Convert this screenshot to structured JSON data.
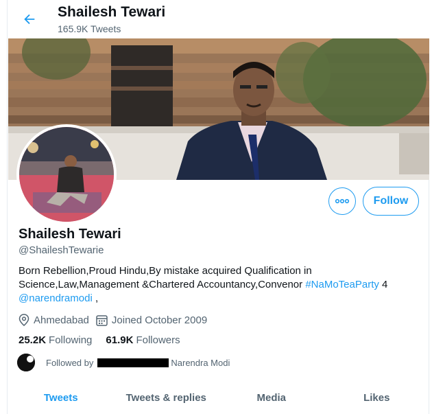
{
  "header": {
    "name": "Shailesh Tewari",
    "tweet_count": "165.9K Tweets"
  },
  "profile": {
    "name": "Shailesh Tewari",
    "handle": "@ShaileshTewarie",
    "bio_part1": "Born Rebellion,Proud Hindu,By mistake acquired Qualification in Science,Law,Management &Chartered Accountancy,Convenor ",
    "bio_hashtag": "#NaMoTeaParty",
    "bio_part2": " 4 ",
    "bio_mention": "@narendramodi",
    "bio_part3": " ,",
    "location": "Ahmedabad",
    "joined": "Joined October 2009"
  },
  "actions": {
    "follow_label": "Follow"
  },
  "stats": {
    "following_count": "25.2K",
    "following_label": "Following",
    "followers_count": "61.9K",
    "followers_label": "Followers"
  },
  "followed_by": {
    "prefix": "Followed by",
    "names": "Narendra Modi"
  },
  "tabs": [
    {
      "label": "Tweets",
      "active": true
    },
    {
      "label": "Tweets & replies",
      "active": false
    },
    {
      "label": "Media",
      "active": false
    },
    {
      "label": "Likes",
      "active": false
    }
  ],
  "colors": {
    "accent": "#1d9bf0",
    "text_secondary": "#536471",
    "text_primary": "#0f1419"
  }
}
